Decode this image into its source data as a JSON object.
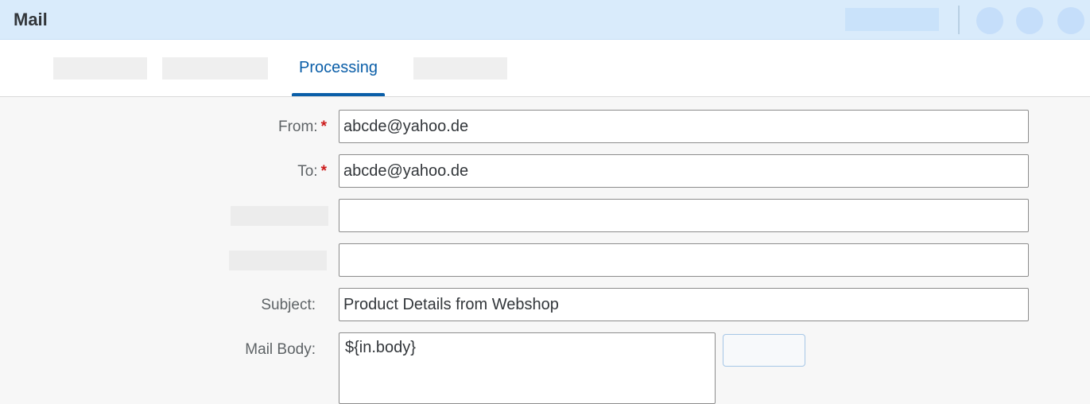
{
  "header": {
    "title": "Mail"
  },
  "tabs": {
    "active_label": "Processing"
  },
  "form": {
    "from": {
      "label": "From:",
      "required_mark": "*",
      "value": "abcde@yahoo.de"
    },
    "to": {
      "label": "To:",
      "required_mark": "*",
      "value": "abcde@yahoo.de"
    },
    "cc": {
      "value": ""
    },
    "bcc": {
      "value": ""
    },
    "subject": {
      "label": "Subject:",
      "value": "Product Details from Webshop"
    },
    "mail_body": {
      "label": "Mail Body:",
      "value": "${in.body}"
    }
  },
  "colors": {
    "header_bg": "#d9ebfb",
    "accent": "#0a5ea8",
    "required": "#cc1b1b"
  }
}
